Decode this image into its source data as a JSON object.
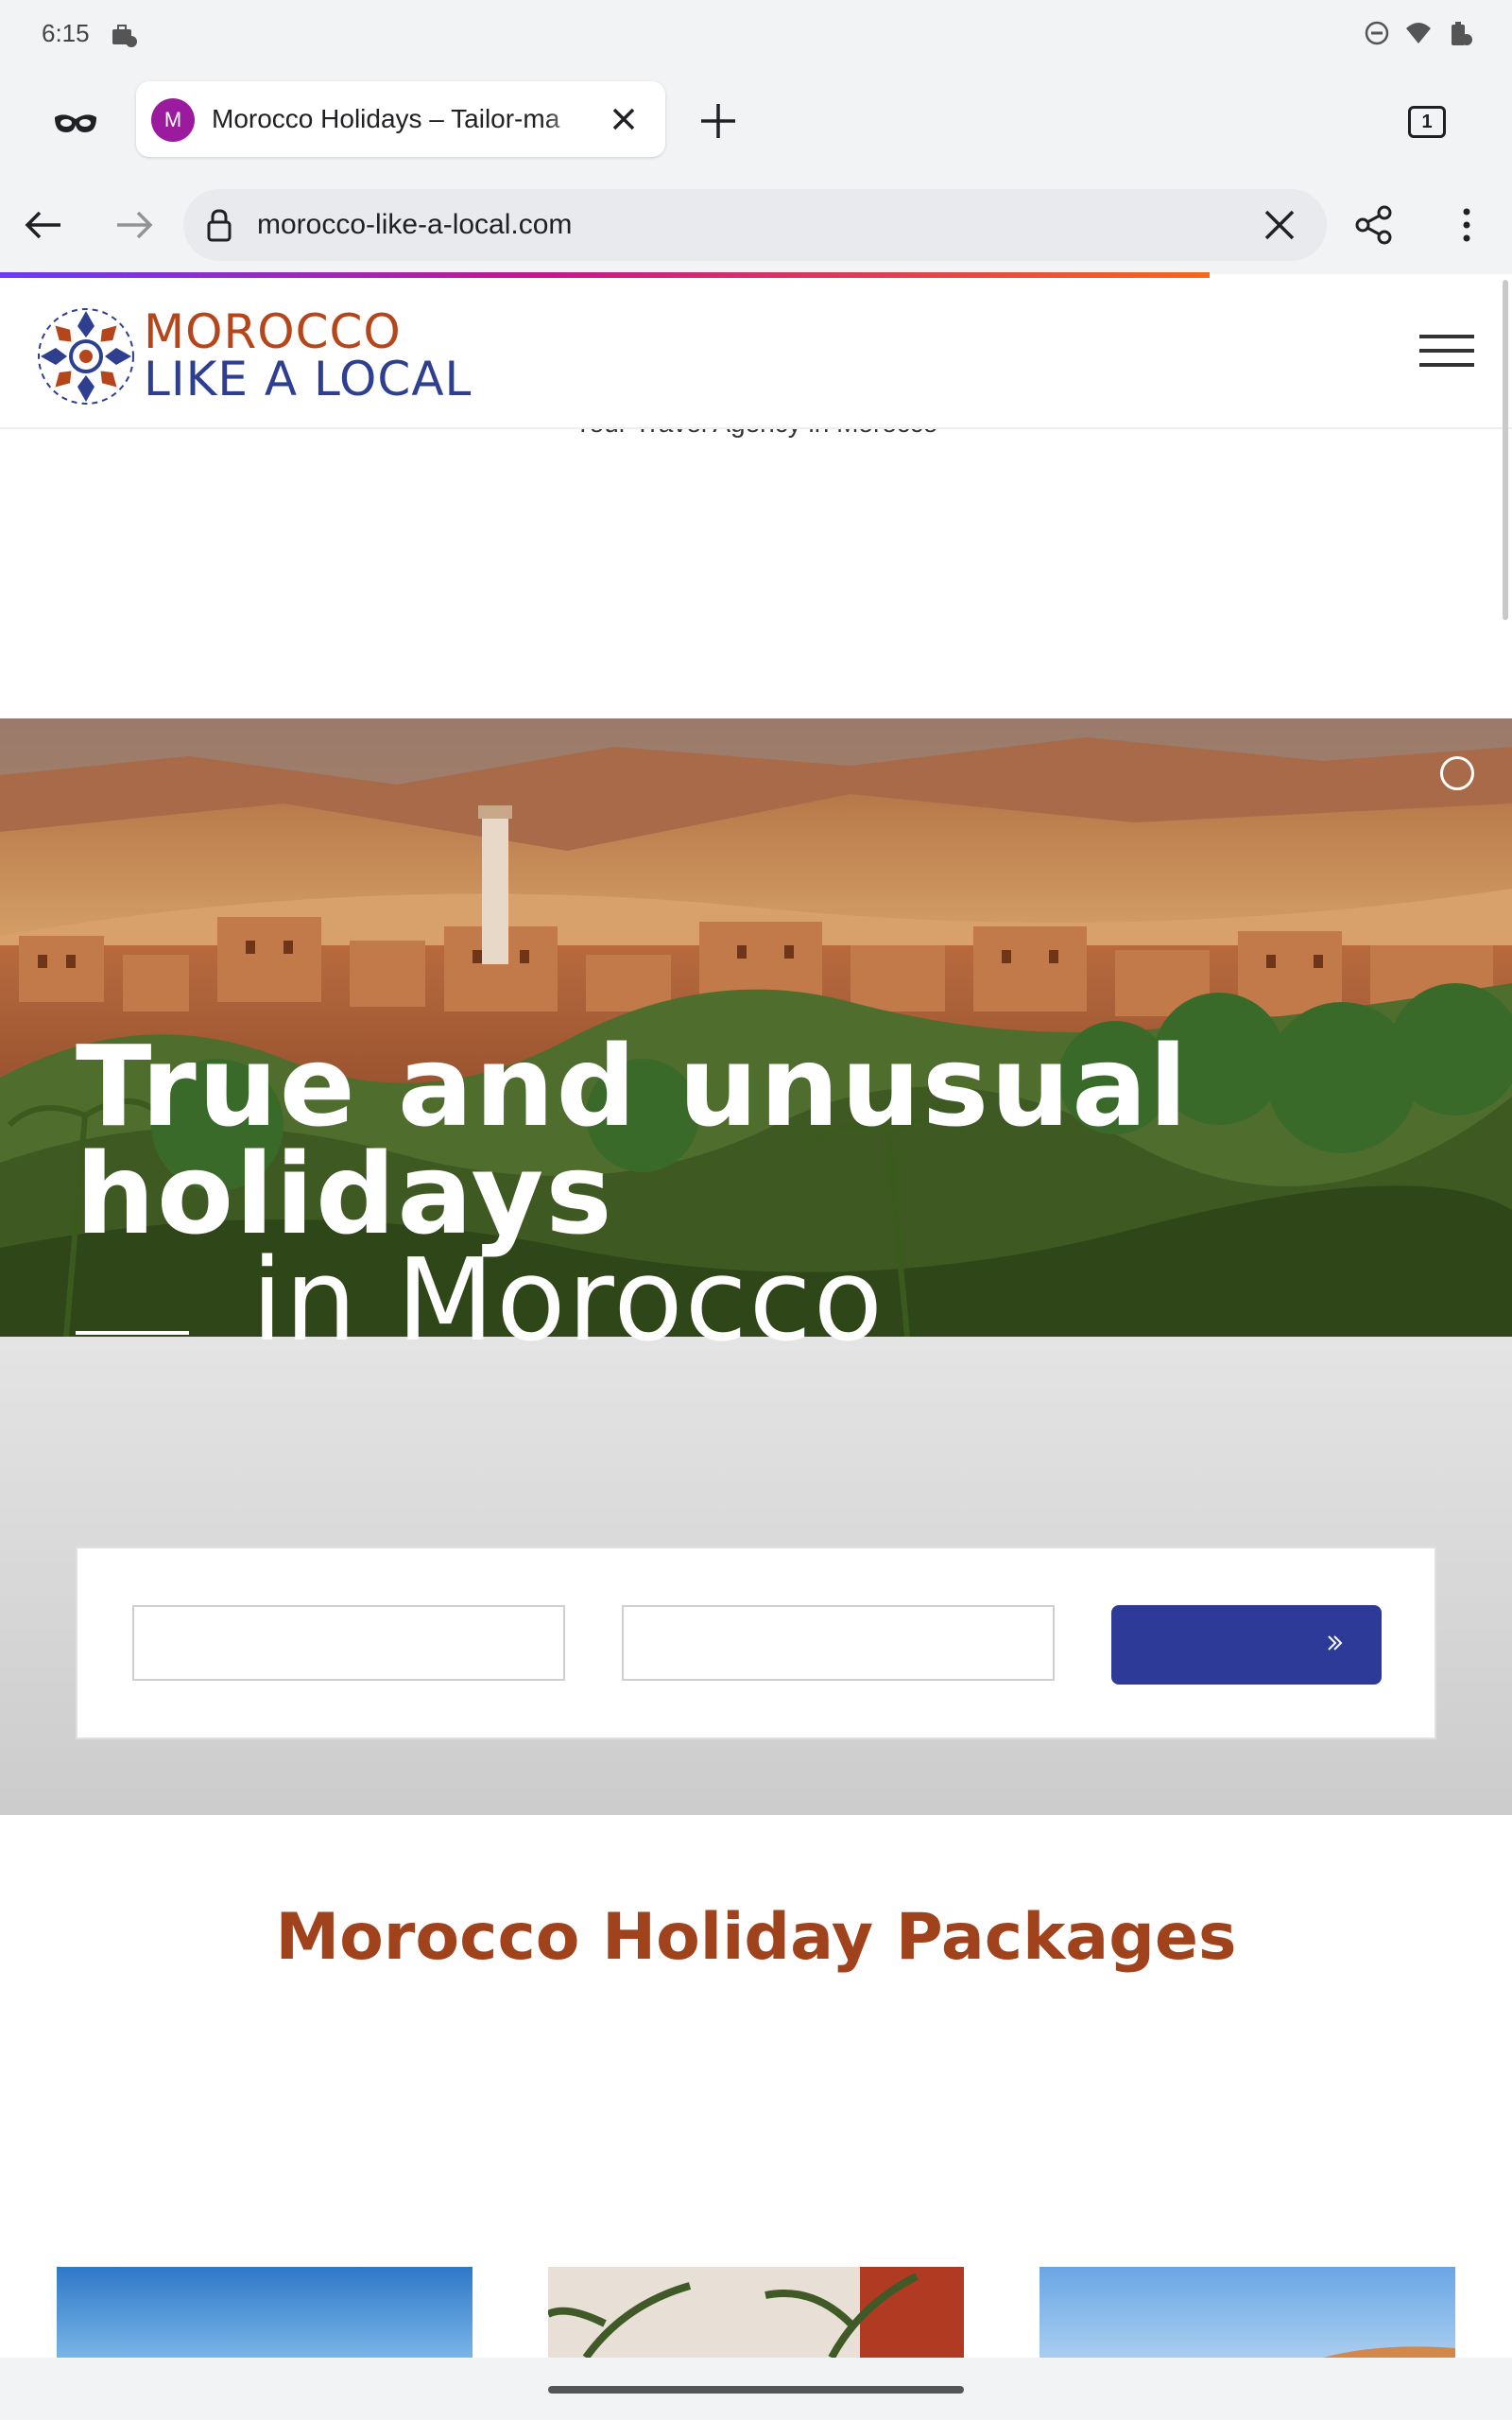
{
  "status_bar": {
    "time": "6:15",
    "icons": [
      "briefcase-icon",
      "dnd-icon",
      "wifi-icon",
      "battery-icon"
    ]
  },
  "browser": {
    "incognito": true,
    "tab": {
      "favicon_letter": "M",
      "favicon_color": "#9c1a9e",
      "title": "Morocco Holidays – Tailor-ma"
    },
    "tab_count": "1",
    "url": "morocco-like-a-local.com"
  },
  "site": {
    "logo": {
      "line1": "MOROCCO",
      "line2": "LIKE A LOCAL"
    },
    "tagline": "Your Travel Agency in Morocco",
    "hero": {
      "line1": "True and unusual",
      "line2": "holidays",
      "line3": "in Morocco"
    },
    "section_title": "Morocco Holiday Packages"
  },
  "colors": {
    "brand_orange": "#b5451b",
    "brand_blue": "#2d3f8e",
    "search_button": "#2e3a98",
    "section_title": "#a0421c"
  }
}
